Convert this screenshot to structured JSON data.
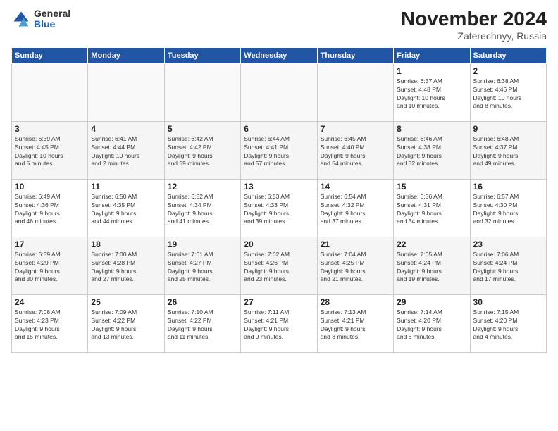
{
  "header": {
    "logo_general": "General",
    "logo_blue": "Blue",
    "month_title": "November 2024",
    "location": "Zaterechnyy, Russia"
  },
  "weekdays": [
    "Sunday",
    "Monday",
    "Tuesday",
    "Wednesday",
    "Thursday",
    "Friday",
    "Saturday"
  ],
  "weeks": [
    [
      {
        "day": "",
        "info": ""
      },
      {
        "day": "",
        "info": ""
      },
      {
        "day": "",
        "info": ""
      },
      {
        "day": "",
        "info": ""
      },
      {
        "day": "",
        "info": ""
      },
      {
        "day": "1",
        "info": "Sunrise: 6:37 AM\nSunset: 4:48 PM\nDaylight: 10 hours\nand 10 minutes."
      },
      {
        "day": "2",
        "info": "Sunrise: 6:38 AM\nSunset: 4:46 PM\nDaylight: 10 hours\nand 8 minutes."
      }
    ],
    [
      {
        "day": "3",
        "info": "Sunrise: 6:39 AM\nSunset: 4:45 PM\nDaylight: 10 hours\nand 5 minutes."
      },
      {
        "day": "4",
        "info": "Sunrise: 6:41 AM\nSunset: 4:44 PM\nDaylight: 10 hours\nand 2 minutes."
      },
      {
        "day": "5",
        "info": "Sunrise: 6:42 AM\nSunset: 4:42 PM\nDaylight: 9 hours\nand 59 minutes."
      },
      {
        "day": "6",
        "info": "Sunrise: 6:44 AM\nSunset: 4:41 PM\nDaylight: 9 hours\nand 57 minutes."
      },
      {
        "day": "7",
        "info": "Sunrise: 6:45 AM\nSunset: 4:40 PM\nDaylight: 9 hours\nand 54 minutes."
      },
      {
        "day": "8",
        "info": "Sunrise: 6:46 AM\nSunset: 4:38 PM\nDaylight: 9 hours\nand 52 minutes."
      },
      {
        "day": "9",
        "info": "Sunrise: 6:48 AM\nSunset: 4:37 PM\nDaylight: 9 hours\nand 49 minutes."
      }
    ],
    [
      {
        "day": "10",
        "info": "Sunrise: 6:49 AM\nSunset: 4:36 PM\nDaylight: 9 hours\nand 46 minutes."
      },
      {
        "day": "11",
        "info": "Sunrise: 6:50 AM\nSunset: 4:35 PM\nDaylight: 9 hours\nand 44 minutes."
      },
      {
        "day": "12",
        "info": "Sunrise: 6:52 AM\nSunset: 4:34 PM\nDaylight: 9 hours\nand 41 minutes."
      },
      {
        "day": "13",
        "info": "Sunrise: 6:53 AM\nSunset: 4:33 PM\nDaylight: 9 hours\nand 39 minutes."
      },
      {
        "day": "14",
        "info": "Sunrise: 6:54 AM\nSunset: 4:32 PM\nDaylight: 9 hours\nand 37 minutes."
      },
      {
        "day": "15",
        "info": "Sunrise: 6:56 AM\nSunset: 4:31 PM\nDaylight: 9 hours\nand 34 minutes."
      },
      {
        "day": "16",
        "info": "Sunrise: 6:57 AM\nSunset: 4:30 PM\nDaylight: 9 hours\nand 32 minutes."
      }
    ],
    [
      {
        "day": "17",
        "info": "Sunrise: 6:59 AM\nSunset: 4:29 PM\nDaylight: 9 hours\nand 30 minutes."
      },
      {
        "day": "18",
        "info": "Sunrise: 7:00 AM\nSunset: 4:28 PM\nDaylight: 9 hours\nand 27 minutes."
      },
      {
        "day": "19",
        "info": "Sunrise: 7:01 AM\nSunset: 4:27 PM\nDaylight: 9 hours\nand 25 minutes."
      },
      {
        "day": "20",
        "info": "Sunrise: 7:02 AM\nSunset: 4:26 PM\nDaylight: 9 hours\nand 23 minutes."
      },
      {
        "day": "21",
        "info": "Sunrise: 7:04 AM\nSunset: 4:25 PM\nDaylight: 9 hours\nand 21 minutes."
      },
      {
        "day": "22",
        "info": "Sunrise: 7:05 AM\nSunset: 4:24 PM\nDaylight: 9 hours\nand 19 minutes."
      },
      {
        "day": "23",
        "info": "Sunrise: 7:06 AM\nSunset: 4:24 PM\nDaylight: 9 hours\nand 17 minutes."
      }
    ],
    [
      {
        "day": "24",
        "info": "Sunrise: 7:08 AM\nSunset: 4:23 PM\nDaylight: 9 hours\nand 15 minutes."
      },
      {
        "day": "25",
        "info": "Sunrise: 7:09 AM\nSunset: 4:22 PM\nDaylight: 9 hours\nand 13 minutes."
      },
      {
        "day": "26",
        "info": "Sunrise: 7:10 AM\nSunset: 4:22 PM\nDaylight: 9 hours\nand 11 minutes."
      },
      {
        "day": "27",
        "info": "Sunrise: 7:11 AM\nSunset: 4:21 PM\nDaylight: 9 hours\nand 9 minutes."
      },
      {
        "day": "28",
        "info": "Sunrise: 7:13 AM\nSunset: 4:21 PM\nDaylight: 9 hours\nand 8 minutes."
      },
      {
        "day": "29",
        "info": "Sunrise: 7:14 AM\nSunset: 4:20 PM\nDaylight: 9 hours\nand 6 minutes."
      },
      {
        "day": "30",
        "info": "Sunrise: 7:15 AM\nSunset: 4:20 PM\nDaylight: 9 hours\nand 4 minutes."
      }
    ]
  ]
}
